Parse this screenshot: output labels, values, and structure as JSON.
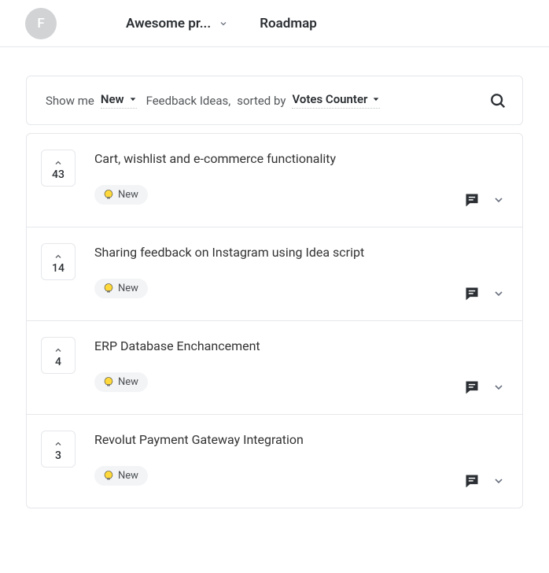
{
  "header": {
    "avatar_initial": "F",
    "project_label": "Awesome pr...",
    "roadmap_label": "Roadmap"
  },
  "filter": {
    "show_me_label": "Show me",
    "status_value": "New",
    "type_label": "Feedback Ideas,",
    "sorted_by_label": "sorted by",
    "sort_value": "Votes Counter"
  },
  "items": [
    {
      "votes": "43",
      "title": "Cart, wishlist and e-commerce functionality",
      "status": "New"
    },
    {
      "votes": "14",
      "title": "Sharing feedback on Instagram using Idea script",
      "status": "New"
    },
    {
      "votes": "4",
      "title": "ERP Database Enchancement",
      "status": "New"
    },
    {
      "votes": "3",
      "title": "Revolut Payment Gateway Integration",
      "status": "New"
    }
  ]
}
